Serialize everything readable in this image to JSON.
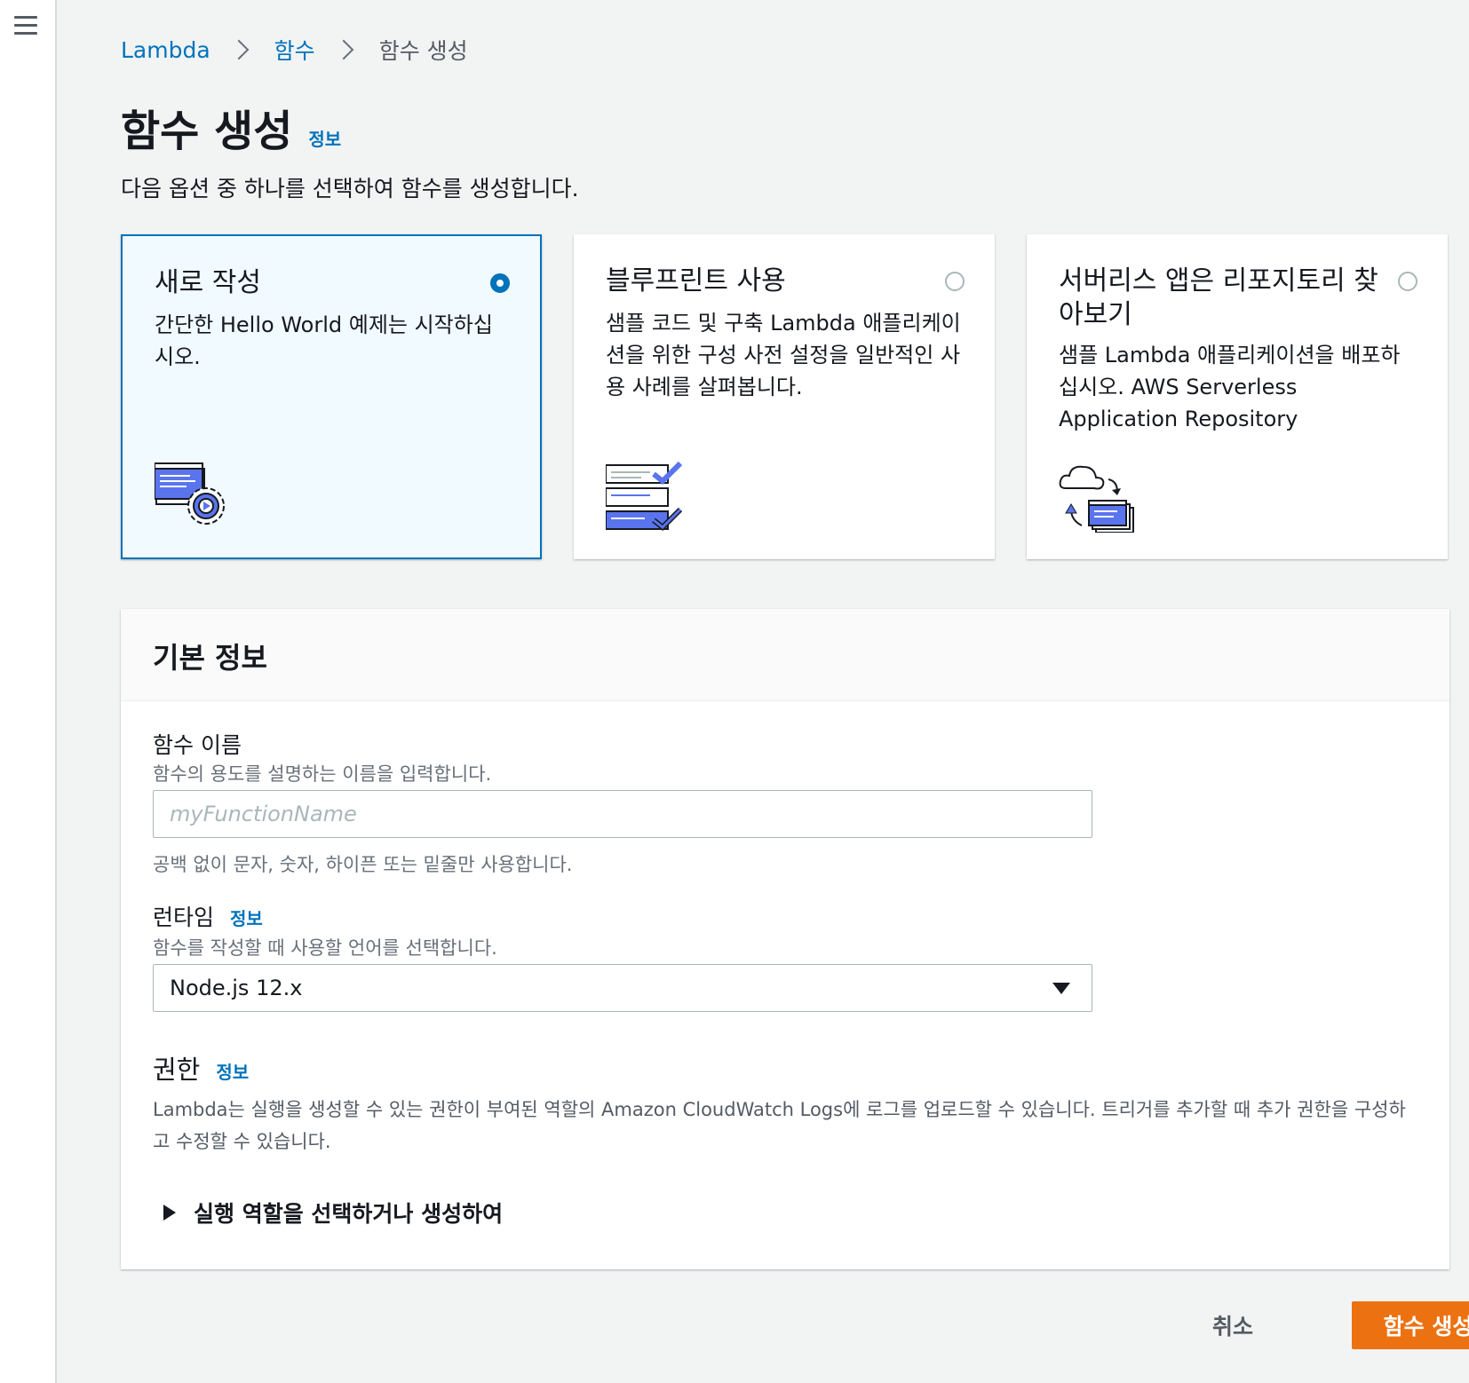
{
  "breadcrumb": {
    "items": [
      "Lambda",
      "함수",
      "함수 생성"
    ]
  },
  "page": {
    "title": "함수 생성",
    "info_label": "정보",
    "intro": "다음 옵션 중 하나를 선택하여 함수를 생성합니다."
  },
  "options": [
    {
      "title": "새로 작성",
      "description": "간단한 Hello World 예제는 시작하십시오.",
      "selected": true,
      "icon": "author-from-scratch-icon"
    },
    {
      "title": "블루프린트 사용",
      "description": "샘플 코드 및 구축 Lambda 애플리케이션을 위한 구성 사전 설정을 일반적인 사용 사례를 살펴봅니다.",
      "selected": false,
      "icon": "blueprint-icon"
    },
    {
      "title": "서버리스 앱은 리포지토리 찾아보기",
      "description": "샘플 Lambda 애플리케이션을 배포하십시오. AWS Serverless Application Repository",
      "selected": false,
      "icon": "serverless-repo-icon"
    }
  ],
  "basic_info": {
    "header": "기본 정보",
    "function_name": {
      "label": "함수 이름",
      "description": "함수의 용도를 설명하는 이름을 입력합니다.",
      "placeholder": "myFunctionName",
      "value": "",
      "hint": "공백 없이 문자, 숫자, 하이픈 또는 밑줄만 사용합니다."
    },
    "runtime": {
      "label": "런타임",
      "info_label": "정보",
      "description": "함수를 작성할 때 사용할 언어를 선택합니다.",
      "selected": "Node.js 12.x"
    },
    "permissions": {
      "label": "권한",
      "info_label": "정보",
      "description": "Lambda는 실행을 생성할 수 있는 권한이 부여된 역할의 Amazon CloudWatch Logs에 로그를 업로드할 수 있습니다. 트리거를 추가할 때 추가 권한을 구성하고 수정할 수 있습니다.",
      "expander_label": "실행 역할을 선택하거나 생성하여"
    }
  },
  "actions": {
    "cancel": "취소",
    "create": "함수 생성"
  },
  "colors": {
    "link": "#0073bb",
    "primary_button": "#ec7211",
    "selected_card_bg": "#f1faff"
  }
}
